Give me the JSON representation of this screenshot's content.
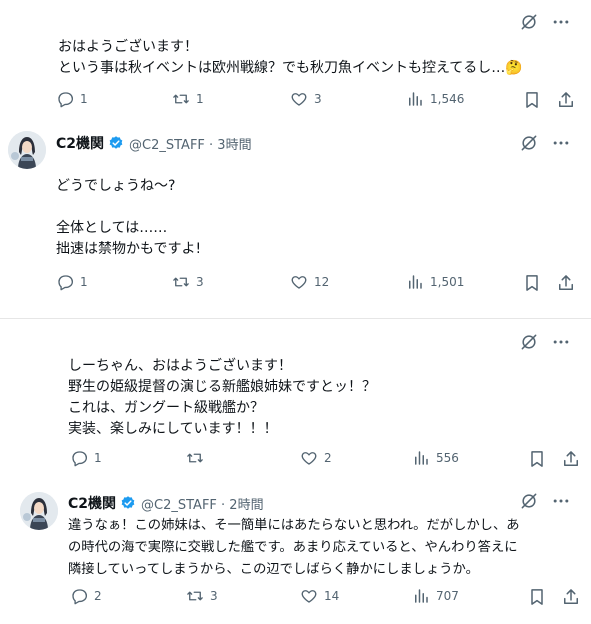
{
  "tweet1": {
    "text": "おはようございます！\nという事は秋イベントは欧州戦線？でも秋刀魚イベントも控えてるし…🤔",
    "replies": "1",
    "retweets": "1",
    "likes": "3",
    "views": "1,546"
  },
  "reply1": {
    "name": "C2機関",
    "handle": "@C2_STAFF · 3時間",
    "text": "どうでしょうね〜?\n\n全体としては……\n拙速は禁物かもですよ!",
    "replies": "1",
    "retweets": "3",
    "likes": "12",
    "views": "1,501"
  },
  "tweet2": {
    "text": "しーちゃん、おはようございます！\n野生の姫級提督の演じる新艦娘姉妹ですとッ！？\nこれは、ガングート級戦艦か？\n実装、楽しみにしています！！！",
    "replies": "1",
    "retweets": "",
    "likes": "2",
    "views": "556"
  },
  "reply2": {
    "name": "C2機関",
    "handle": "@C2_STAFF · 2時間",
    "text": "違うなぁ！この姉妹は、そ一簡単にはあたらないと思われ。だがしかし、あ\nの時代の海で実際に交戦した艦です。あまり応えていると、やんわり答えに\n隣接していってしまうから、この辺でしばらく静かにしましょうか。",
    "replies": "2",
    "retweets": "3",
    "likes": "14",
    "views": "707"
  },
  "colors": {
    "accent": "#1d9bf0",
    "muted": "#536471",
    "text": "#0f1419"
  }
}
